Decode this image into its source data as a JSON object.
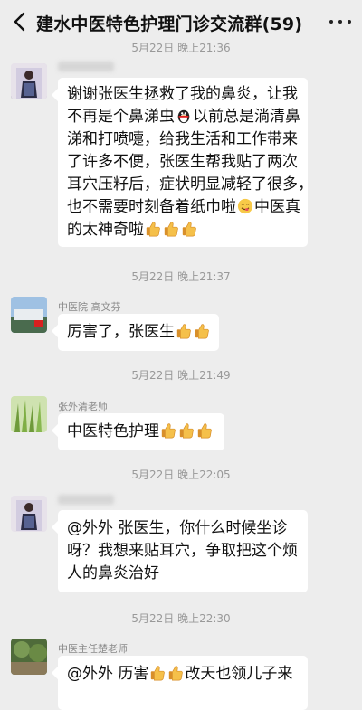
{
  "header": {
    "title": "建水中医特色护理门诊交流群(59)"
  },
  "messages": [
    {
      "time": "5月22日 晚上21:36",
      "sender": "",
      "lines": [
        "谢谢张医生拯救了我的鼻炎，让我",
        "不再是个鼻涕虫",
        "以前总是淌清鼻",
        "涕和打喷嚏，给我生活和工作带来",
        "了许多不便，张医生帮我贴了两次",
        "耳穴压籽后，症状明显减轻了很多，",
        "也不需要时刻备着纸巾啦",
        "中医真",
        "的太神奇啦"
      ]
    },
    {
      "time": "5月22日 晚上21:37",
      "sender": "中医院 高文芬",
      "text": "厉害了，张医生"
    },
    {
      "time": "5月22日 晚上21:49",
      "sender": "张外清老师",
      "text": "中医特色护理"
    },
    {
      "time": "5月22日 晚上22:05",
      "sender": "",
      "lines": [
        "@外外  张医生，你什么时候坐诊",
        "呀？我想来贴耳穴，争取把这个烦",
        "人的鼻炎治好"
      ]
    },
    {
      "time": "5月22日 晚上22:30",
      "sender": "中医主任楚老师",
      "lines": [
        "@外外  历害",
        "改天也领儿子来"
      ]
    }
  ],
  "icons": {
    "back": "chevron-left-icon",
    "more": "more-dots-icon",
    "thumbs": "thumbs-up-emoji",
    "penguin": "penguin-emoji",
    "yum": "yum-face-emoji"
  },
  "colors": {
    "background": "#ededed",
    "bubble": "#ffffff",
    "thumb": "#f2b640"
  }
}
